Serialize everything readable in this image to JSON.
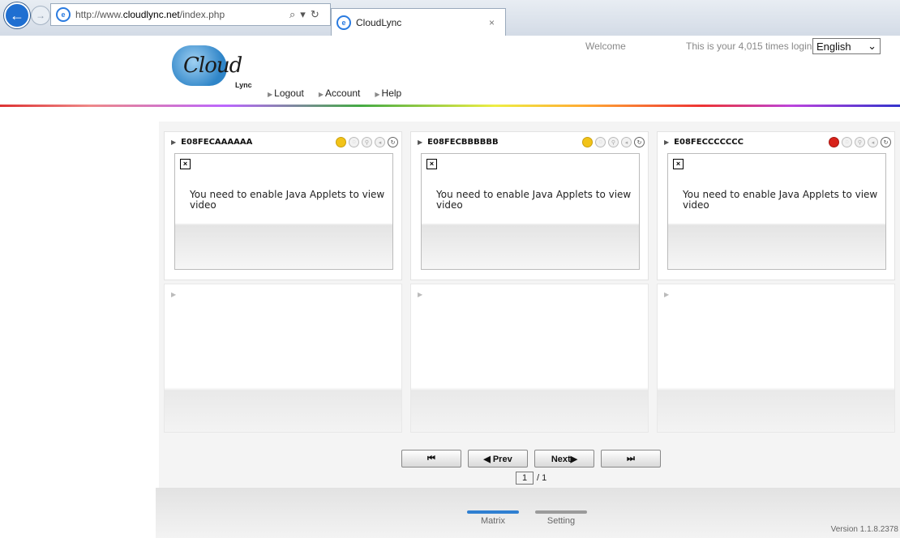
{
  "browser": {
    "url_prefix": "http://www.",
    "url_domain": "cloudlync.net",
    "url_path": "/index.php",
    "tab_title": "CloudLync",
    "tab_close": "×",
    "search_icon": "⌕",
    "dropdown_icon": "▾",
    "refresh_icon": "↻"
  },
  "header": {
    "logo_text": "Cloud",
    "logo_sub": "Lync",
    "welcome": "Welcome",
    "login_count": "This is your 4,015 times login.",
    "language": "English",
    "nav": {
      "logout": "Logout",
      "account": "Account",
      "help": "Help"
    }
  },
  "cameras": [
    {
      "id": "E08FECAAAAAA",
      "status": "yellow",
      "message": "You need to enable Java Applets to view video"
    },
    {
      "id": "E08FECBBBBBB",
      "status": "yellow",
      "message": "You need to enable Java Applets to view video"
    },
    {
      "id": "E08FECCCCCCC",
      "status": "red",
      "message": "You need to enable Java Applets to view video"
    }
  ],
  "pager": {
    "first": "⏮",
    "prev": "◀ Prev",
    "next": "Next▶",
    "last": "⏭",
    "current_page": "1",
    "total": "/ 1"
  },
  "footer": {
    "tab_matrix": "Matrix",
    "tab_setting": "Setting",
    "version": "Version 1.1.8.2378",
    "colors": {
      "matrix_accent": "#2f7fd1",
      "setting_accent": "#9a9a9a"
    }
  },
  "icons": [
    "back-arrow-icon",
    "forward-arrow-icon",
    "ie-icon",
    "status-light-icon",
    "snapshot-icon",
    "zoom-icon",
    "audio-icon",
    "refresh-icon",
    "broken-image-icon"
  ]
}
